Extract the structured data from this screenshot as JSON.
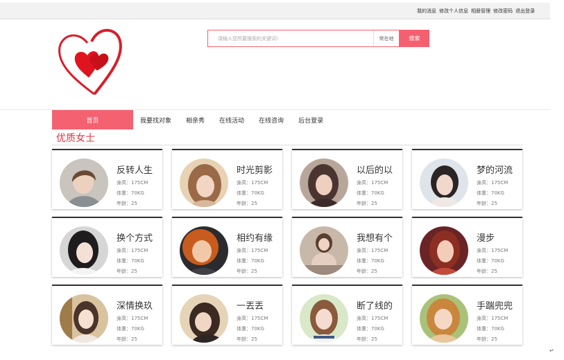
{
  "topbar": {
    "links": [
      "我的消息",
      "修改个人信息",
      "相册管理",
      "修改密码",
      "退出登录"
    ]
  },
  "search": {
    "placeholder": "请输入您所要搜索的关键词!",
    "city": "常在地",
    "button": "搜索"
  },
  "nav": {
    "items": [
      "首页",
      "我要找对象",
      "相亲秀",
      "在线活动",
      "在线咨询",
      "后台登录"
    ]
  },
  "section": {
    "title": "优质女士"
  },
  "cards": [
    {
      "name": "反转人生",
      "height": "身高：175CM",
      "weight": "体重：70KG",
      "age": "年龄：25"
    },
    {
      "name": "时光剪影",
      "height": "身高：175CM",
      "weight": "体重：70KG",
      "age": "年龄：25"
    },
    {
      "name": "以后的以",
      "height": "身高：175CM",
      "weight": "体重：70KG",
      "age": "年龄：25"
    },
    {
      "name": "梦的河流",
      "height": "身高：175CM",
      "weight": "体重：70KG",
      "age": "年龄：25"
    },
    {
      "name": "换个方式",
      "height": "身高：175CM",
      "weight": "体重：70KG",
      "age": "年龄：25"
    },
    {
      "name": "相约有缘",
      "height": "身高：175CM",
      "weight": "体重：70KG",
      "age": "年龄：25"
    },
    {
      "name": "我想有个",
      "height": "身高：175CM",
      "weight": "体重：70KG",
      "age": "年龄：25"
    },
    {
      "name": "漫步",
      "height": "身高：175CM",
      "weight": "体重：70KG",
      "age": "年龄：25"
    },
    {
      "name": "深情换玖",
      "height": "身高：175CM",
      "weight": "体重：70KG",
      "age": "年龄：25"
    },
    {
      "name": "一丟丟",
      "height": "身高：175CM",
      "weight": "体重：70KG",
      "age": "年龄：25"
    },
    {
      "name": "断了线的",
      "height": "身高：175CM",
      "weight": "体重：70KG",
      "age": "年龄：25"
    },
    {
      "name": "手踹兜兜",
      "height": "身高：175CM",
      "weight": "体重：70KG",
      "age": "年龄：25"
    }
  ],
  "colors": {
    "accent": "#f46170",
    "title_red": "#e5303f",
    "logo_red": "#d81e28"
  },
  "icons": {
    "logo": "double-heart-logo-icon",
    "corner": "return-arrow-icon"
  },
  "corner_mark": "↵"
}
